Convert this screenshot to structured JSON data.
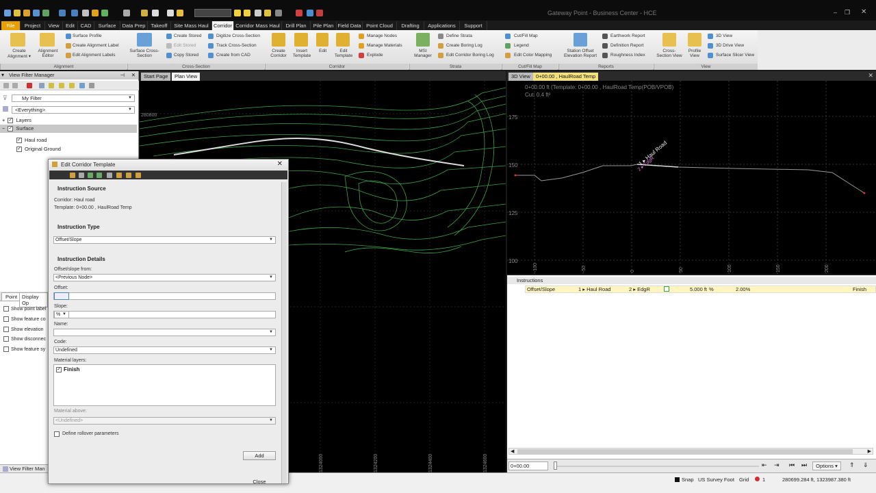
{
  "app": {
    "title": "Gateway Point - Business Center - HCE"
  },
  "menu": {
    "tabs": [
      "File",
      "Project",
      "View",
      "Edit",
      "CAD",
      "Surface",
      "Data Prep",
      "Takeoff",
      "Site Mass Haul",
      "Corridor",
      "Corridor Mass Haul",
      "Drill Plan",
      "Pile Plan",
      "Field Data",
      "Point Cloud",
      "Drafting",
      "Applications",
      "Support"
    ]
  },
  "ribbon": {
    "alignment": {
      "create_label": "Create Alignment ▾",
      "editor_label": "Alignment Editor",
      "items": [
        "Surface Profile",
        "Create Alignment Label",
        "Edit Alignment Labels"
      ],
      "group": "Alignment"
    },
    "cross_section": {
      "big_label": "Surface Cross-Section",
      "items": [
        "Create Stored",
        "Edit Stored",
        "Copy Stored",
        "Digitize Cross-Section",
        "Track Cross-Section",
        "Create from CAD"
      ],
      "group": "Cross-Section"
    },
    "corridor": {
      "big": [
        "Create Corridor",
        "Insert Template",
        "Edit",
        "Edit Template"
      ],
      "items": [
        "Manage Nodes",
        "Manage Materials",
        "Explode"
      ],
      "group": "Corridor"
    },
    "strata": {
      "big_label": "MSI Manager",
      "items": [
        "Define Strata",
        "Create Boring Log",
        "Edit Corridor Boring Log"
      ],
      "group": "Strata"
    },
    "cutfill": {
      "items": [
        "Cut/Fill Map",
        "Legend",
        "Edit Color Mapping"
      ],
      "group": "Cut/Fill Map"
    },
    "reports": {
      "big_label": "Station Offset Elevation Report",
      "items": [
        "Earthwork Report",
        "Definition Report",
        "Roughness Index"
      ],
      "group": "Reports"
    },
    "view": {
      "big": [
        "Cross-Section View",
        "Profile View"
      ],
      "items": [
        "3D View",
        "3D Drive View",
        "Surface Slicer View"
      ],
      "group": "View"
    }
  },
  "vfm": {
    "title": "View Filter Manager",
    "filter": "My Filter",
    "everything": "<Everything>",
    "tree": [
      {
        "label": "Layers",
        "indent": 0
      },
      {
        "label": "Surface",
        "indent": 0,
        "selected": true
      },
      {
        "label": "Haul road",
        "indent": 1
      },
      {
        "label": "Original Ground",
        "indent": 1
      }
    ],
    "tabs": [
      "Point",
      "Display Op"
    ],
    "options": [
      "Show point label",
      "Show feature co",
      "Show elevation",
      "Show disconnec",
      "Show feature sy"
    ],
    "bottom_tab": "View Filter Man"
  },
  "plan": {
    "tabs": [
      "Start Page",
      "Plan View"
    ],
    "northing_label": "280800",
    "x_ticks": [
      "1324000",
      "1324200",
      "1324400",
      "1324600"
    ]
  },
  "view3d": {
    "tabs": [
      "3D View",
      "0+00.00 , HaulRoad Temp"
    ],
    "info1": "0+00.00 ft (Template: 0+00.00 , HaulRoad Temp(POB/VPOB)",
    "info2": "Cut: 0.4 ft²",
    "y_ticks": [
      "175",
      "150",
      "125",
      "100"
    ],
    "x_ticks": [
      "-100",
      "-50",
      "0",
      "50",
      "100",
      "150",
      "200"
    ],
    "annot1": "1 ▸ Haul Road",
    "annot2": "2 ▸ EdgR"
  },
  "instructions": {
    "title": "Instructions",
    "row": [
      "Offset/Slope",
      "1 ▸ Haul Road",
      "2 ▸ EdgR",
      "5.000 ft",
      "%",
      "2.00%",
      "Finish"
    ]
  },
  "bottombar": {
    "station": "0+00.00",
    "options": "Options ▾"
  },
  "status": {
    "snap": "Snap",
    "units": "US Survey Foot",
    "grid": "Grid",
    "warn": "1",
    "coords": "280699.284 ft, 1323987.380 ft"
  },
  "dialog": {
    "title": "Edit Corridor Template",
    "source_hdr": "Instruction Source",
    "corridor": "Corridor: Haul road",
    "template": "Template: 0+00.00 , HaulRoad Temp",
    "type_hdr": "Instruction Type",
    "type_value": "Offset/Slope",
    "details_hdr": "Instruction Details",
    "offset_from_label": "Offset/slope from:",
    "offset_from_value": "<Previous Node>",
    "offset_label": "Offset:",
    "slope_label": "Slope:",
    "slope_unit": "%",
    "name_label": "Name:",
    "code_label": "Code:",
    "code_value": "Undefined",
    "material_label": "Material layers:",
    "material_item": "Finish",
    "above_label": "Material above:",
    "above_value": "<Undefined>",
    "rollover_label": "Define rollover parameters",
    "add_label": "Add",
    "close_label": "Close"
  }
}
